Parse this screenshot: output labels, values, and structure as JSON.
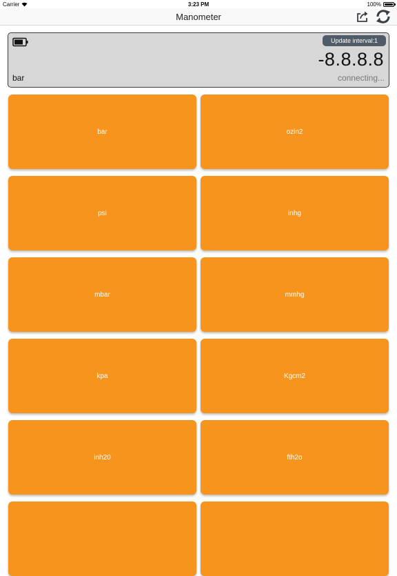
{
  "status_bar": {
    "carrier": "Carrier",
    "time": "3:23 PM",
    "battery": "100%"
  },
  "nav": {
    "title": "Manometer",
    "share_icon": "share-icon",
    "refresh_icon": "refresh-icon"
  },
  "display": {
    "update_interval_label": "Update interval:1",
    "reading": "-8.8.8.8",
    "unit": "bar",
    "status": "connecting...",
    "battery_icon": "battery-icon"
  },
  "units": [
    {
      "label": "bar"
    },
    {
      "label": "ozin2"
    },
    {
      "label": "psi"
    },
    {
      "label": "inhg"
    },
    {
      "label": "mbar"
    },
    {
      "label": "mmhg"
    },
    {
      "label": "kpa"
    },
    {
      "label": "Kgcm2"
    },
    {
      "label": "inh20"
    },
    {
      "label": "fth2o"
    },
    {
      "label": ""
    },
    {
      "label": ""
    }
  ],
  "colors": {
    "accent": "#f7941e",
    "panel": "#d7d7d7",
    "update_button": "#4f5b66"
  }
}
